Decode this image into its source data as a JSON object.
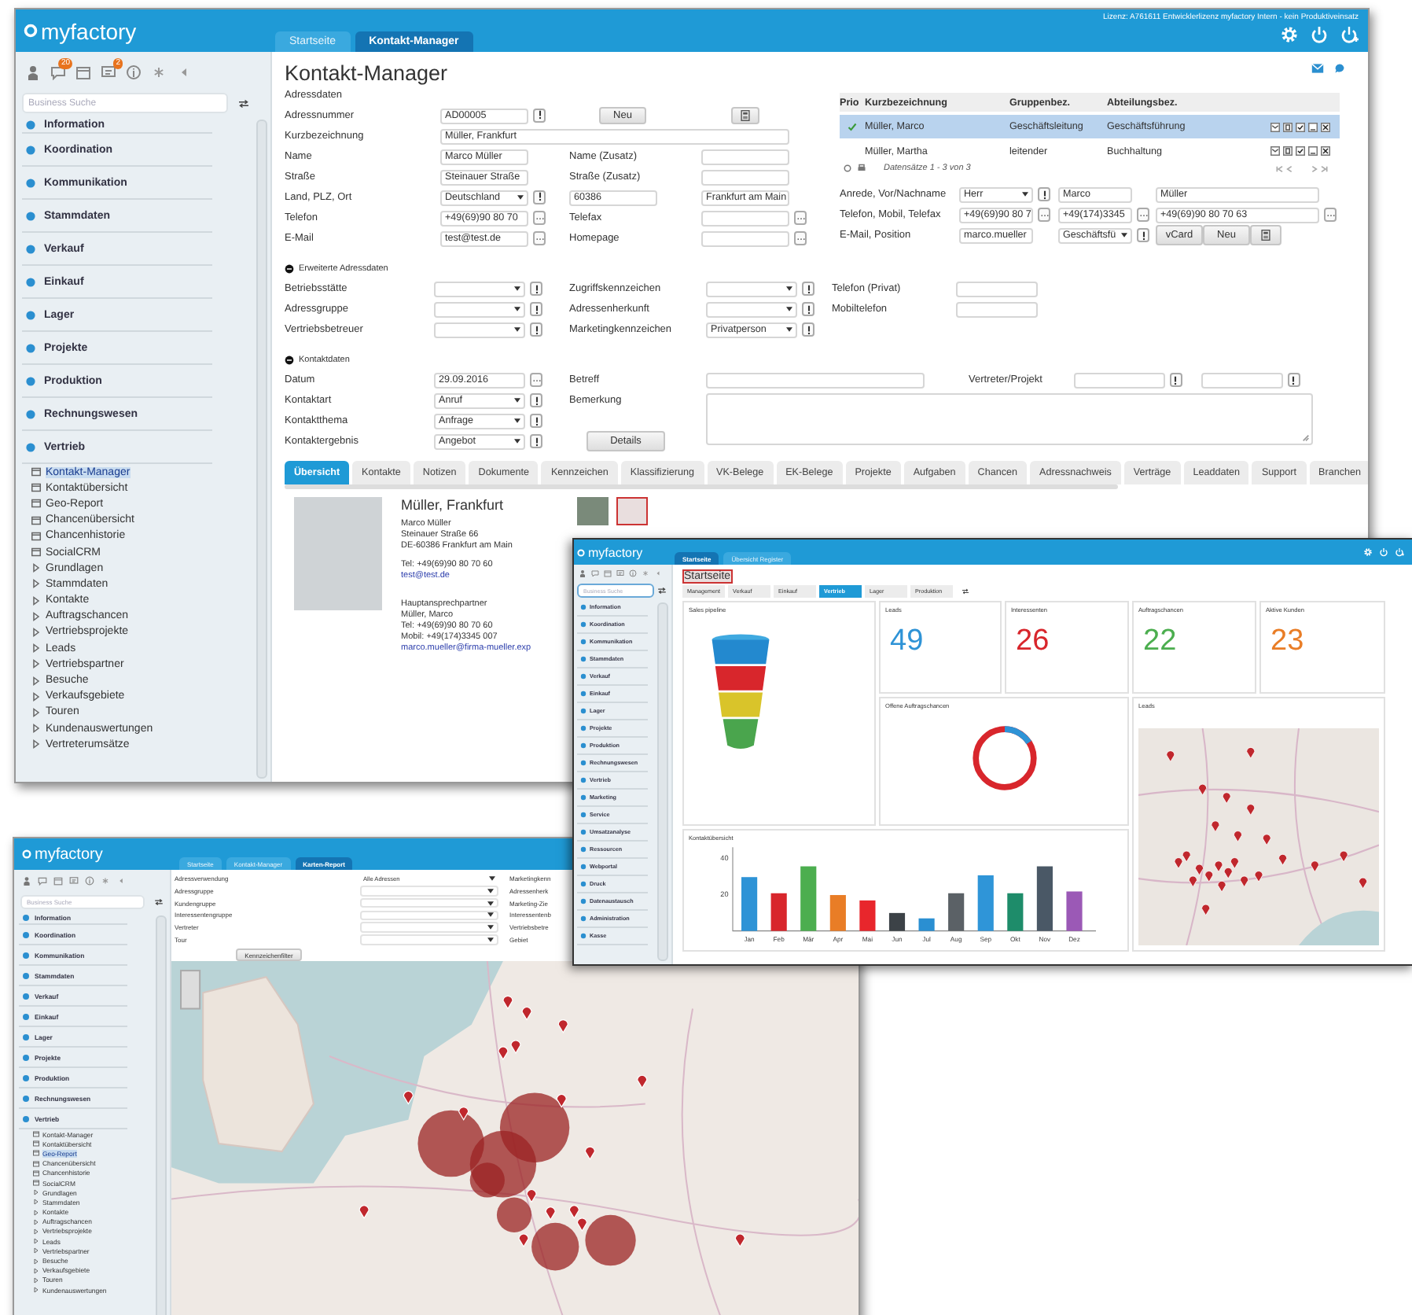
{
  "contact_manager": {
    "logo": "myfactory",
    "tabs": [
      {
        "label": "Startseite",
        "selected": false
      },
      {
        "label": "Kontakt-Manager",
        "selected": true
      }
    ],
    "license": "Lizenz: A761611 Entwicklerlizenz myfactory Intern - kein Produktiveinsatz",
    "sidebar": {
      "badges": [
        "20",
        "2"
      ],
      "search_placeholder": "Business Suche",
      "nav": [
        {
          "label": "Information"
        },
        {
          "label": "Koordination"
        },
        {
          "label": "Kommunikation"
        },
        {
          "label": "Stammdaten"
        },
        {
          "label": "Verkauf"
        },
        {
          "label": "Einkauf"
        },
        {
          "label": "Lager"
        },
        {
          "label": "Projekte"
        },
        {
          "label": "Produktion"
        },
        {
          "label": "Rechnungswesen"
        },
        {
          "label": "Vertrieb"
        }
      ],
      "subitems": [
        {
          "label": "Kontakt-Manager",
          "kind": "page",
          "selected": true
        },
        {
          "label": "Kontaktübersicht",
          "kind": "page",
          "selected": false
        },
        {
          "label": "Geo-Report",
          "kind": "page",
          "selected": false
        },
        {
          "label": "Chancenübersicht",
          "kind": "page",
          "selected": false
        },
        {
          "label": "Chancenhistorie",
          "kind": "page",
          "selected": false
        },
        {
          "label": "SocialCRM",
          "kind": "page",
          "selected": false
        },
        {
          "label": "Grundlagen",
          "kind": "folder",
          "selected": false
        },
        {
          "label": "Stammdaten",
          "kind": "folder",
          "selected": false
        },
        {
          "label": "Kontakte",
          "kind": "folder",
          "selected": false
        },
        {
          "label": "Auftragschancen",
          "kind": "folder",
          "selected": false
        },
        {
          "label": "Vertriebsprojekte",
          "kind": "folder",
          "selected": false
        },
        {
          "label": "Leads",
          "kind": "folder",
          "selected": false
        },
        {
          "label": "Vertriebspartner",
          "kind": "folder",
          "selected": false
        },
        {
          "label": "Besuche",
          "kind": "folder",
          "selected": false
        },
        {
          "label": "Verkaufsgebiete",
          "kind": "folder",
          "selected": false
        },
        {
          "label": "Touren",
          "kind": "folder",
          "selected": false
        },
        {
          "label": "Kundenauswertungen",
          "kind": "folder",
          "selected": false
        },
        {
          "label": "Vertreterumsätze",
          "kind": "folder",
          "selected": false
        }
      ]
    },
    "title": "Kontakt-Manager",
    "address": {
      "heading": "Adressdaten",
      "adressnummer": {
        "label": "Adressnummer",
        "value": "AD00005"
      },
      "new_button": "Neu",
      "kurzbezeichnung": {
        "label": "Kurzbezeichnung",
        "value": "Müller, Frankfurt"
      },
      "name": {
        "label": "Name",
        "value": "Marco Müller"
      },
      "name_zusatz": {
        "label": "Name (Zusatz)"
      },
      "strasse": {
        "label": "Straße",
        "value": "Steinauer Straße"
      },
      "strasse_zusatz": {
        "label": "Straße (Zusatz)"
      },
      "land_plz_ort": {
        "label": "Land, PLZ, Ort",
        "country": "Deutschland",
        "zip": "60386",
        "city": "Frankfurt am Main"
      },
      "telefon": {
        "label": "Telefon",
        "value": "+49(69)90 80 70"
      },
      "telefax": {
        "label": "Telefax"
      },
      "email": {
        "label": "E-Mail",
        "value": "test@test.de"
      },
      "homepage": {
        "label": "Homepage"
      }
    },
    "contacts_table": {
      "columns": [
        "Prio",
        "Kurzbezeichnung",
        "Gruppenbez.",
        "Abteilungsbez."
      ],
      "rows": [
        {
          "checked": true,
          "selected": true,
          "cells": [
            "",
            "Müller, Marco",
            "Geschäftsleitung",
            "Geschäftsführung"
          ]
        },
        {
          "checked": false,
          "selected": false,
          "cells": [
            "",
            "Müller, Martha",
            "leitender",
            "Buchhaltung"
          ]
        }
      ],
      "footer": "Datensätze 1 - 3 von 3"
    },
    "contact_person": {
      "anrede_label": "Anrede, Vor/Nachname",
      "anrede": "Herr",
      "first_name": "Marco",
      "last_name": "Müller",
      "phone_label": "Telefon, Mobil, Telefax",
      "phone": "+49(69)90 80 7",
      "mobile": "+49(174)3345",
      "fax": "+49(69)90 80 70 63",
      "email_label": "E-Mail, Position",
      "email": "marco.mueller",
      "position": "Geschäftsfü",
      "buttons": [
        "vCard",
        "Neu"
      ]
    },
    "extended": {
      "heading": "Erweiterte Adressdaten",
      "rows": [
        {
          "left": {
            "label": "Betriebsstätte"
          },
          "middle": {
            "label": "Zugriffskennzeichen"
          },
          "right": {
            "label": "Telefon (Privat)"
          }
        },
        {
          "left": {
            "label": "Adressgruppe"
          },
          "middle": {
            "label": "Adressenherkunft"
          },
          "right": {
            "label": "Mobiltelefon"
          }
        },
        {
          "left": {
            "label": "Vertriebsbetreuer"
          },
          "middle": {
            "label": "Marketingkennzeichen",
            "value": "Privatperson"
          }
        }
      ]
    },
    "contact_data": {
      "heading": "Kontaktdaten",
      "datum": {
        "label": "Datum",
        "value": "29.09.2016"
      },
      "betreff": {
        "label": "Betreff"
      },
      "vertreter": {
        "label": "Vertreter/Projekt"
      },
      "bemerkung": {
        "label": "Bemerkung"
      },
      "selects": [
        {
          "label": "Kontaktart",
          "value": "Anruf"
        },
        {
          "label": "Kontaktthema",
          "value": "Anfrage"
        },
        {
          "label": "Kontaktergebnis",
          "value": "Angebot"
        }
      ],
      "details_button": "Details"
    },
    "detail_tabs": [
      {
        "label": "Übersicht",
        "selected": true
      },
      {
        "label": "Kontakte",
        "selected": false
      },
      {
        "label": "Notizen",
        "selected": false
      },
      {
        "label": "Dokumente",
        "selected": false
      },
      {
        "label": "Kennzeichen",
        "selected": false
      },
      {
        "label": "Klassifizierung",
        "selected": false
      },
      {
        "label": "VK-Belege",
        "selected": false
      },
      {
        "label": "EK-Belege",
        "selected": false
      },
      {
        "label": "Projekte",
        "selected": false
      },
      {
        "label": "Aufgaben",
        "selected": false
      },
      {
        "label": "Chancen",
        "selected": false
      },
      {
        "label": "Adressnachweis",
        "selected": false
      },
      {
        "label": "Verträge",
        "selected": false
      },
      {
        "label": "Leaddaten",
        "selected": false
      },
      {
        "label": "Support",
        "selected": false
      },
      {
        "label": "Branchen",
        "selected": false
      }
    ],
    "overview": {
      "heading": "Müller, Frankfurt",
      "address_lines": [
        "Marco Müller",
        "Steinauer Straße 66",
        "DE-60386 Frankfurt am Main"
      ],
      "phone": "Tel: +49(69)90 80 70 60",
      "email": "test@test.de",
      "contact_heading": "Hauptansprechpartner",
      "contact_lines": [
        "Müller, Marco",
        "Tel: +49(69)90 80 70 60",
        "Mobil: +49(174)3345 007"
      ],
      "contact_email": "marco.mueller@firma-mueller.exp"
    }
  },
  "map_window": {
    "logo": "myfactory",
    "tabs": [
      {
        "label": "Startseite",
        "selected": false
      },
      {
        "label": "Kontakt-Manager",
        "selected": false
      },
      {
        "label": "Karten-Report",
        "selected": true
      }
    ],
    "sidebar": {
      "search_placeholder": "Business Suche",
      "nav": [
        {
          "label": "Information"
        },
        {
          "label": "Koordination"
        },
        {
          "label": "Kommunikation"
        },
        {
          "label": "Stammdaten"
        },
        {
          "label": "Verkauf"
        },
        {
          "label": "Einkauf"
        },
        {
          "label": "Lager"
        },
        {
          "label": "Projekte"
        },
        {
          "label": "Produktion"
        },
        {
          "label": "Rechnungswesen"
        },
        {
          "label": "Vertrieb"
        }
      ],
      "subitems": [
        {
          "label": "Kontakt-Manager",
          "kind": "page",
          "selected": false
        },
        {
          "label": "Kontaktübersicht",
          "kind": "page",
          "selected": false
        },
        {
          "label": "Geo-Report",
          "kind": "page",
          "selected": true
        },
        {
          "label": "Chancenübersicht",
          "kind": "page",
          "selected": false
        },
        {
          "label": "Chancenhistorie",
          "kind": "page",
          "selected": false
        },
        {
          "label": "SocialCRM",
          "kind": "page",
          "selected": false
        },
        {
          "label": "Grundlagen",
          "kind": "folder",
          "selected": false
        },
        {
          "label": "Stammdaten",
          "kind": "folder",
          "selected": false
        },
        {
          "label": "Kontakte",
          "kind": "folder",
          "selected": false
        },
        {
          "label": "Auftragschancen",
          "kind": "folder",
          "selected": false
        },
        {
          "label": "Vertriebsprojekte",
          "kind": "folder",
          "selected": false
        },
        {
          "label": "Leads",
          "kind": "folder",
          "selected": false
        },
        {
          "label": "Vertriebspartner",
          "kind": "folder",
          "selected": false
        },
        {
          "label": "Besuche",
          "kind": "folder",
          "selected": false
        },
        {
          "label": "Verkaufsgebiete",
          "kind": "folder",
          "selected": false
        },
        {
          "label": "Touren",
          "kind": "folder",
          "selected": false
        },
        {
          "label": "Kundenauswertungen",
          "kind": "folder",
          "selected": false
        }
      ]
    },
    "filters": [
      {
        "label": "Adressverwendung",
        "value": "Alle Adressen"
      },
      {
        "label": "Adressgruppe"
      },
      {
        "label": "Kundengruppe"
      },
      {
        "label": "Interessentengruppe"
      },
      {
        "label": "Vertreter"
      },
      {
        "label": "Tour"
      }
    ],
    "filter_labels_right": [
      "Marketingkenn",
      "Adressenherk",
      "Marketing-Zie",
      "Interessentenb",
      "Vertriebsbetre",
      "Gebiet"
    ],
    "filter_button": "Kennzeichenfilter"
  },
  "dashboard": {
    "logo": "myfactory",
    "tabs": [
      {
        "label": "Startseite",
        "selected": true
      },
      {
        "label": "Übersicht Register",
        "selected": false
      }
    ],
    "sidebar": {
      "search_placeholder": "Business Suche",
      "nav": [
        {
          "label": "Information"
        },
        {
          "label": "Koordination"
        },
        {
          "label": "Kommunikation"
        },
        {
          "label": "Stammdaten"
        },
        {
          "label": "Verkauf"
        },
        {
          "label": "Einkauf"
        },
        {
          "label": "Lager"
        },
        {
          "label": "Projekte"
        },
        {
          "label": "Produktion"
        },
        {
          "label": "Rechnungswesen"
        },
        {
          "label": "Vertrieb"
        },
        {
          "label": "Marketing"
        },
        {
          "label": "Service"
        },
        {
          "label": "Umsatzanalyse"
        },
        {
          "label": "Ressourcen"
        },
        {
          "label": "Webportal"
        },
        {
          "label": "Druck"
        },
        {
          "label": "Datenaustausch"
        },
        {
          "label": "Administration"
        },
        {
          "label": "Kasse"
        }
      ]
    },
    "title": "Startseite",
    "section_tabs": [
      {
        "label": "Management",
        "selected": false
      },
      {
        "label": "Verkauf",
        "selected": false
      },
      {
        "label": "Einkauf",
        "selected": false
      },
      {
        "label": "Vertrieb",
        "selected": true
      },
      {
        "label": "Lager",
        "selected": false
      },
      {
        "label": "Produktion",
        "selected": false
      }
    ],
    "funnel_title": "Sales pipeline",
    "kpis": [
      {
        "label": "Leads",
        "value": "49",
        "color": "#2e93d6"
      },
      {
        "label": "Interessenten",
        "value": "26",
        "color": "#d8262c"
      },
      {
        "label": "Auftragschancen",
        "value": "22",
        "color": "#4cae4f"
      },
      {
        "label": "Aktive Kunden",
        "value": "23",
        "color": "#e97d26"
      }
    ],
    "donut_title": "Offene Auftragschancen",
    "map_title": "Leads",
    "bar_card": {
      "title": "Kontaktübersicht",
      "chart_data": {
        "type": "bar",
        "categories": [
          "Jan",
          "Feb",
          "Mär",
          "Apr",
          "Mai",
          "Jun",
          "Jul",
          "Aug",
          "Sep",
          "Okt",
          "Nov",
          "Dez"
        ],
        "series": [
          {
            "color": "#2e93d6",
            "values": [
              30,
              null,
              null,
              null,
              null,
              null,
              null,
              null,
              null,
              null,
              null,
              null
            ]
          },
          {
            "color": "#d8262c",
            "values": [
              null,
              21,
              null,
              null,
              null,
              null,
              null,
              null,
              null,
              null,
              null,
              null
            ]
          },
          {
            "color": "#4cae4f",
            "values": [
              null,
              null,
              36,
              null,
              null,
              null,
              null,
              null,
              null,
              null,
              null,
              null
            ]
          },
          {
            "color": "#e97d26",
            "values": [
              null,
              null,
              null,
              20,
              null,
              null,
              null,
              null,
              null,
              null,
              null,
              null
            ]
          },
          {
            "color": "#e8262c",
            "values": [
              null,
              null,
              null,
              null,
              17,
              null,
              null,
              null,
              null,
              null,
              null,
              null
            ]
          },
          {
            "color": "#3c4247",
            "values": [
              null,
              null,
              null,
              null,
              null,
              10,
              null,
              null,
              null,
              null,
              null,
              null
            ]
          },
          {
            "color": "#2a8fd2",
            "values": [
              null,
              null,
              null,
              null,
              null,
              null,
              7,
              null,
              null,
              null,
              null,
              null
            ]
          },
          {
            "color": "#5b6166",
            "values": [
              null,
              null,
              null,
              null,
              null,
              null,
              null,
              21,
              null,
              null,
              null,
              null
            ]
          },
          {
            "color": "#2f95d8",
            "values": [
              null,
              null,
              null,
              null,
              null,
              null,
              null,
              null,
              31,
              null,
              null,
              null
            ]
          },
          {
            "color": "#1e8c6a",
            "values": [
              null,
              null,
              null,
              null,
              null,
              null,
              null,
              null,
              null,
              21,
              null,
              null
            ]
          },
          {
            "color": "#4a5866",
            "values": [
              null,
              null,
              null,
              null,
              null,
              null,
              null,
              null,
              null,
              null,
              36,
              null
            ]
          },
          {
            "color": "#9b59b6",
            "values": [
              null,
              null,
              null,
              null,
              null,
              null,
              null,
              null,
              null,
              null,
              null,
              22
            ]
          }
        ],
        "ylim": [
          0,
          45
        ],
        "yticks": [
          20,
          40
        ]
      }
    }
  }
}
